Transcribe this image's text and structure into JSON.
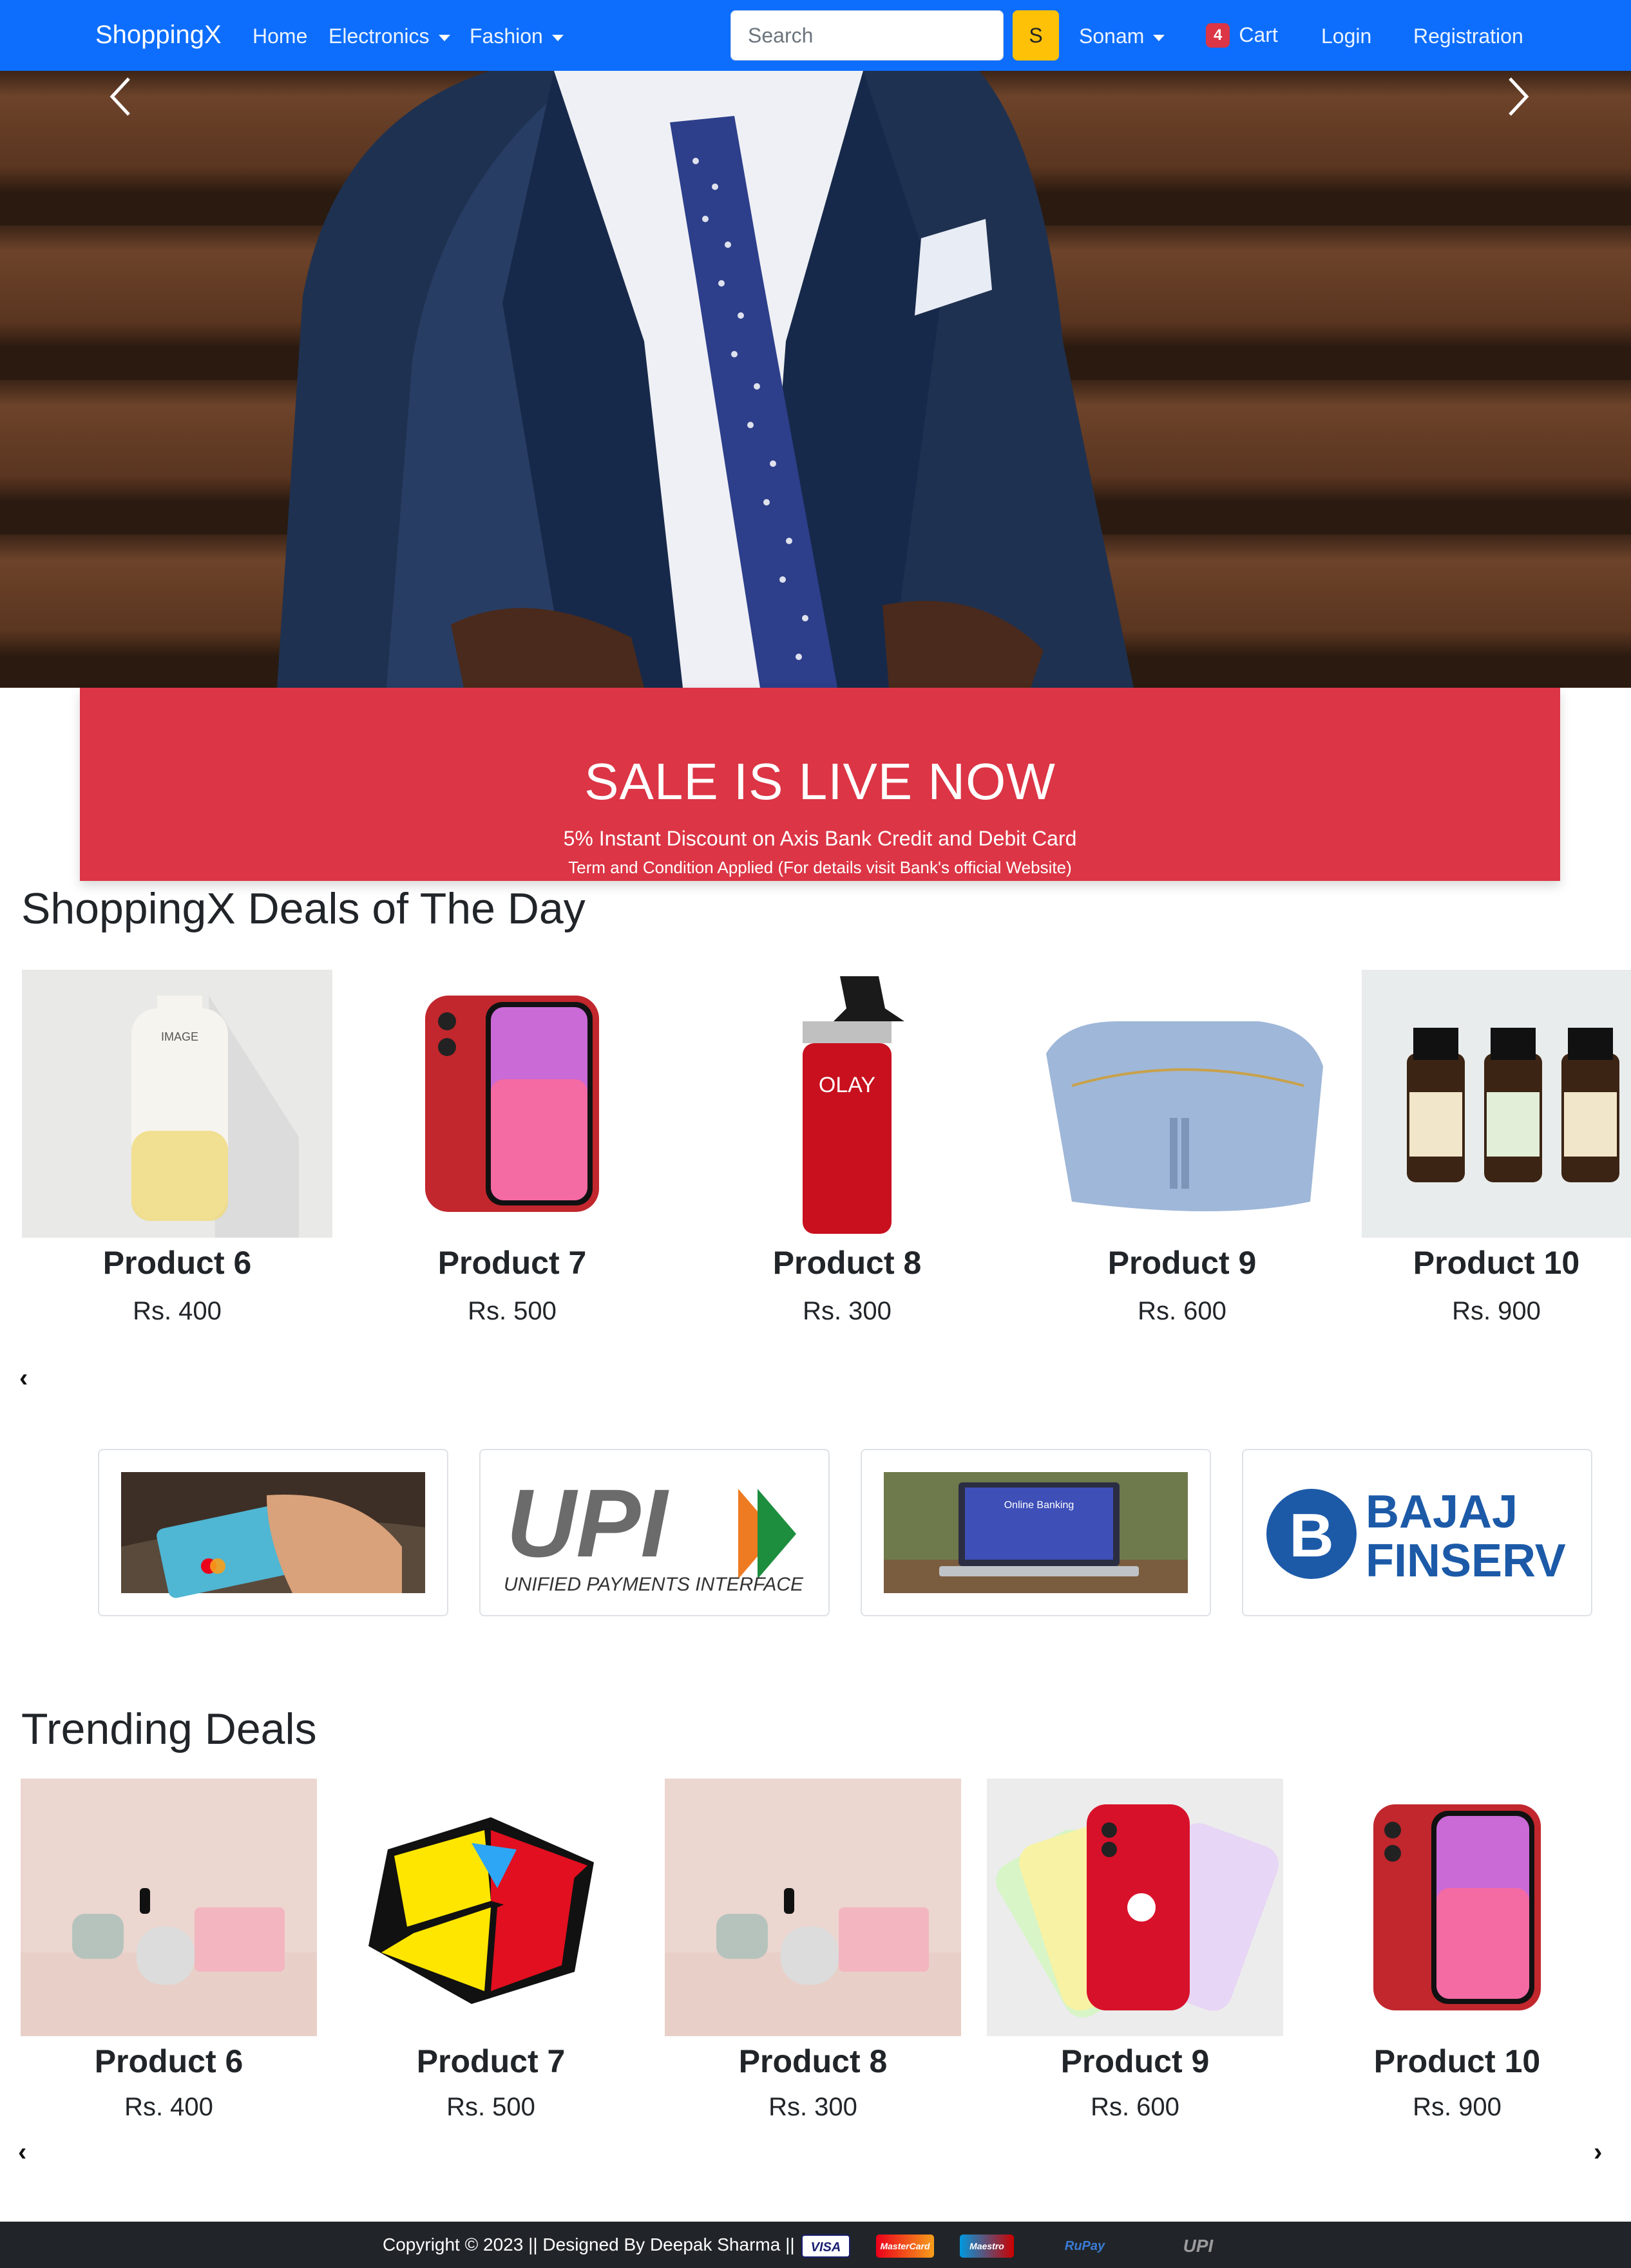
{
  "navbar": {
    "brand": "ShoppingX",
    "links": {
      "home": "Home",
      "electronics": "Electronics",
      "fashion": "Fashion"
    },
    "search": {
      "placeholder": "Search",
      "button": "S"
    },
    "user": "Sonam",
    "cart": {
      "count": "4",
      "label": "Cart"
    },
    "login": "Login",
    "registration": "Registration"
  },
  "sale": {
    "title": "SALE IS LIVE NOW",
    "subtitle": "5% Instant Discount on Axis Bank Credit and Debit Card",
    "terms": "Term and Condition Applied (For details visit Bank's official Website)"
  },
  "deals": {
    "title": "ShoppingX Deals of The Day",
    "products": [
      {
        "name": "Product 6",
        "price": "Rs. 400"
      },
      {
        "name": "Product 7",
        "price": "Rs. 500"
      },
      {
        "name": "Product 8",
        "price": "Rs. 300"
      },
      {
        "name": "Product 9",
        "price": "Rs. 600"
      },
      {
        "name": "Product 10",
        "price": "Rs. 900"
      }
    ]
  },
  "payment_logos": {
    "upi_text": "UPI",
    "upi_caption": "UNIFIED PAYMENTS INTERFACE",
    "online_banking": "Online Banking",
    "bajaj_line1": "BAJAJ",
    "bajaj_line2": "FINSERV"
  },
  "trending": {
    "title": "Trending Deals",
    "products": [
      {
        "name": "Product 6",
        "price": "Rs. 400"
      },
      {
        "name": "Product 7",
        "price": "Rs. 500"
      },
      {
        "name": "Product 8",
        "price": "Rs. 300"
      },
      {
        "name": "Product 9",
        "price": "Rs. 600"
      },
      {
        "name": "Product 10",
        "price": "Rs. 900"
      }
    ]
  },
  "footer": {
    "text": "Copyright © 2023 || Designed By Deepak Sharma ||",
    "logos": [
      "VISA",
      "MasterCard",
      "Maestro",
      "RuPay",
      "UPI"
    ]
  }
}
